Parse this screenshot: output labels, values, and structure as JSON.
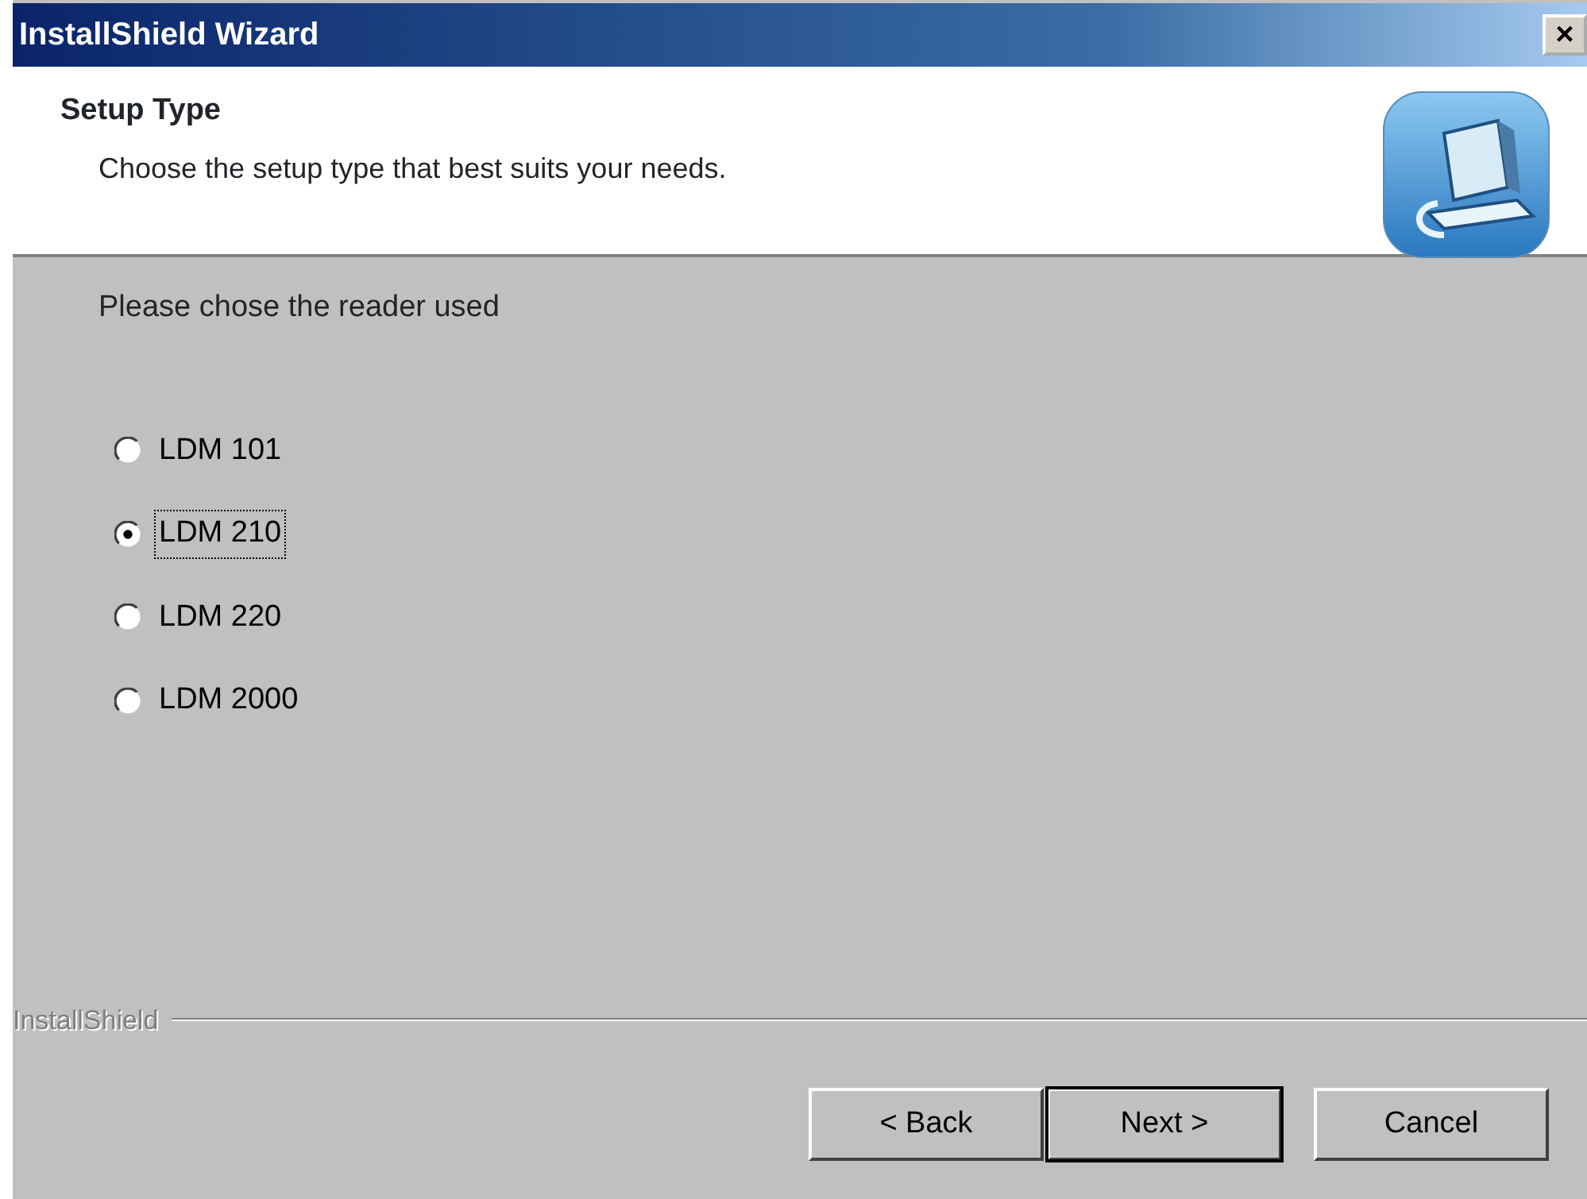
{
  "window": {
    "title": "InstallShield Wizard",
    "close": "×"
  },
  "header": {
    "title": "Setup Type",
    "subtitle": "Choose the setup type that best suits your needs."
  },
  "prompt": "Please chose the reader used",
  "options": [
    {
      "label": "LDM 101",
      "selected": false
    },
    {
      "label": "LDM 210",
      "selected": true
    },
    {
      "label": "LDM 220",
      "selected": false
    },
    {
      "label": "LDM 2000",
      "selected": false
    }
  ],
  "brand": "InstallShield",
  "buttons": [
    {
      "label": "< Back",
      "default": false
    },
    {
      "label": "Next >",
      "default": true
    },
    {
      "label": "Cancel",
      "default": false
    }
  ]
}
